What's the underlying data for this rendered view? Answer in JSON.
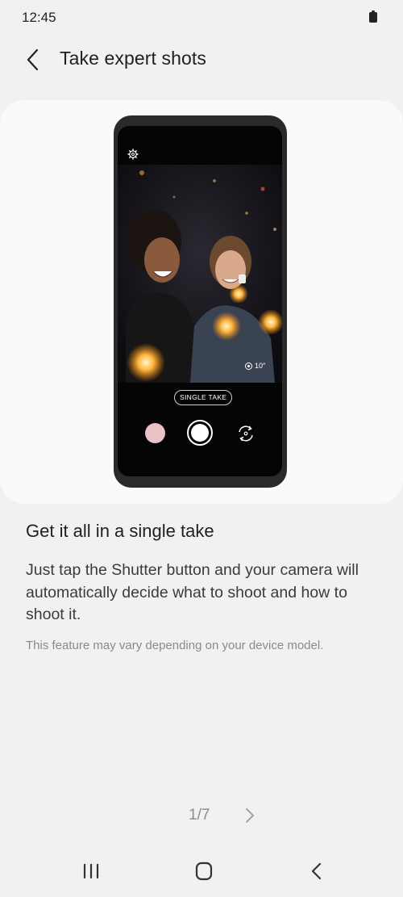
{
  "status_bar": {
    "time": "12:45",
    "battery_icon": "battery-icon"
  },
  "header": {
    "title": "Take expert shots",
    "back_icon": "chevron-left-icon"
  },
  "preview": {
    "mode_label": "SINGLE TAKE",
    "timer_label": "10″",
    "gallery_thumb_color": "#e8c2c5",
    "icons": [
      "settings-icon",
      "timer-icon",
      "shutter-button",
      "switch-camera-icon"
    ]
  },
  "content": {
    "heading": "Get it all in a single take",
    "body": "Just tap the Shutter button and your camera will automatically decide what to shoot and how to shoot it.",
    "note": "This feature may vary depending on your device model."
  },
  "pager": {
    "label": "1/7",
    "next_icon": "chevron-right-icon"
  },
  "nav_bar": {
    "icons": [
      "recents-icon",
      "home-icon",
      "back-icon"
    ]
  },
  "colors": {
    "background": "#f1f1f1",
    "card": "#fafafa",
    "phone_frame": "#2a2a2a"
  }
}
